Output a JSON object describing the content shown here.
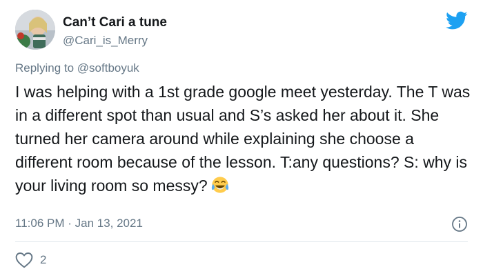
{
  "user": {
    "display_name": "Can’t Cari a tune",
    "handle": "@Cari_is_Merry",
    "avatar_icon": "profile-photo"
  },
  "brand": {
    "logo_icon": "twitter-bird-icon",
    "color": "#1DA1F2"
  },
  "reply": {
    "prefix": "Replying to ",
    "mention": "@softboyuk"
  },
  "tweet": {
    "text": "I was helping with a 1st grade google meet yesterday. The T was in a different spot than usual and S’s asked her about it. She turned her camera around while explaining she choose a different room because of the lesson. T:any questions? S: why is your living room so messy?",
    "emoji_icon": "tears-of-joy-emoji",
    "timestamp": "11:06 PM · Jan 13, 2021"
  },
  "actions": {
    "like_icon": "heart-icon",
    "like_count": "2",
    "info_icon": "info-icon"
  }
}
